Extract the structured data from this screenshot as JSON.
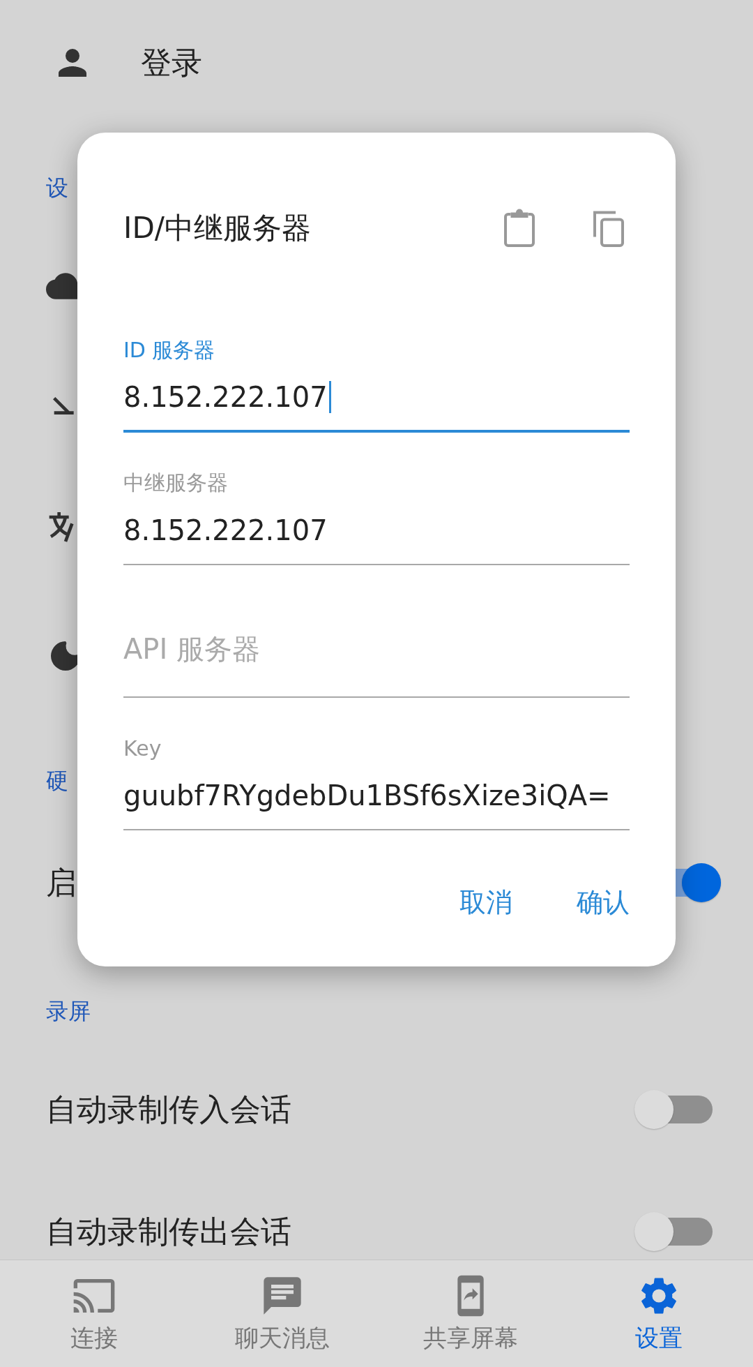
{
  "header": {
    "title": "登录"
  },
  "settings": [
    {
      "kind": "section",
      "label": "设"
    },
    {
      "kind": "row"
    },
    {
      "kind": "row"
    },
    {
      "kind": "row"
    },
    {
      "kind": "row"
    },
    {
      "kind": "section",
      "label": "硬"
    },
    {
      "kind": "toggle",
      "label": "启",
      "on": true
    },
    {
      "kind": "section",
      "label": "录屏"
    },
    {
      "kind": "toggle",
      "label": "自动录制传入会话",
      "on": false
    },
    {
      "kind": "toggle",
      "label": "自动录制传出会话",
      "on": false
    }
  ],
  "dialog": {
    "title": "ID/中继服务器",
    "fields": [
      {
        "label": "ID 服务器",
        "value": "8.152.222.107",
        "focused": true
      },
      {
        "label": "中继服务器",
        "value": "8.152.222.107",
        "focused": false
      },
      {
        "placeholder": "API 服务器",
        "focused": false
      },
      {
        "label": "Key",
        "value": "guubf7RYgdebDu1BSf6sXize3iQA=",
        "focused": false
      }
    ],
    "buttons": [
      "取消",
      "确认"
    ]
  },
  "nav": [
    {
      "label": "连接",
      "selected": false
    },
    {
      "label": "聊天消息",
      "selected": false
    },
    {
      "label": "共享屏幕",
      "selected": false
    },
    {
      "label": "设置",
      "selected": true
    }
  ]
}
